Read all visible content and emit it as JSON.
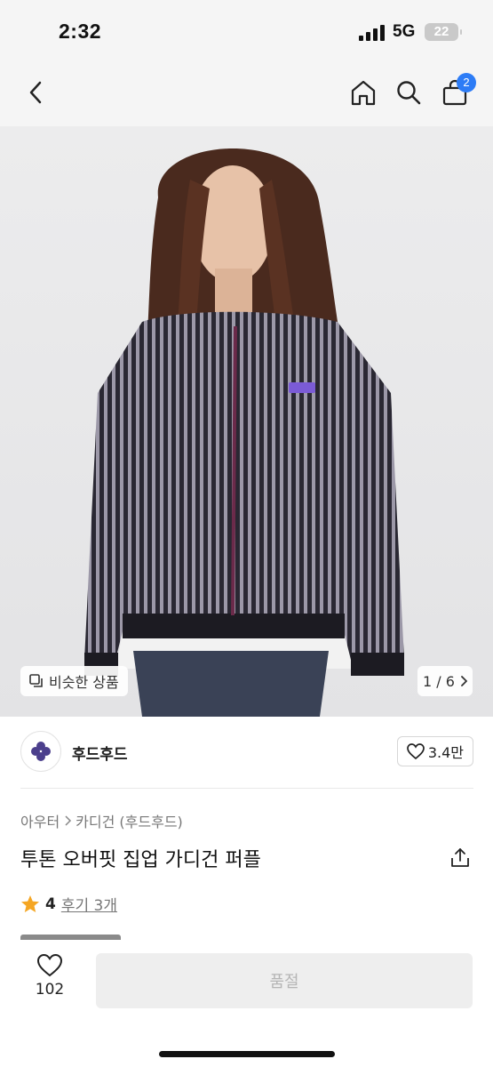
{
  "status_bar": {
    "time": "2:32",
    "network": "5G",
    "battery": "22"
  },
  "nav": {
    "back_icon": "chevron-left-icon",
    "home_icon": "home-icon",
    "search_icon": "search-icon",
    "cart_icon": "shopping-bag-icon",
    "cart_count": "2"
  },
  "hero": {
    "similar_label": "비슷한 상품",
    "page_current": "1",
    "page_total": "6",
    "page_text": "1 / 6"
  },
  "shop": {
    "name": "후드후드",
    "likes": "3.4만"
  },
  "product": {
    "category_1": "아우터",
    "category_2": "카디건 (후드후드)",
    "title": "투톤 오버핏 집업 가디건 퍼플",
    "rating": "4",
    "review_link": "후기 3개"
  },
  "bottom": {
    "fav_count": "102",
    "buy_label": "품절"
  },
  "colors": {
    "accent": "#2d7cf6",
    "star": "#f5a623",
    "disabled_bg": "#eeeeee",
    "disabled_text": "#b5b5b5",
    "shop_logo": "#4b3f8c"
  }
}
